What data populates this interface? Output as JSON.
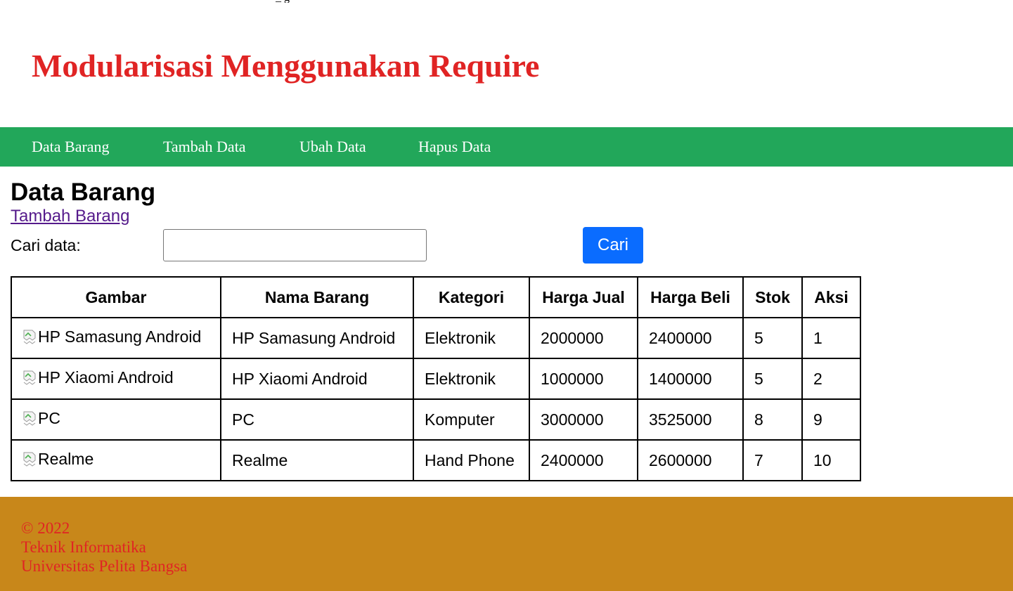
{
  "page_title": "Modularisasi Menggunakan Require",
  "nav": {
    "items": [
      {
        "label": "Data Barang"
      },
      {
        "label": "Tambah Data"
      },
      {
        "label": "Ubah Data"
      },
      {
        "label": "Hapus Data"
      }
    ]
  },
  "main": {
    "heading": "Data Barang",
    "add_link": "Tambah Barang",
    "search": {
      "label": "Cari data:",
      "value": "",
      "button_label": "Cari"
    },
    "table": {
      "columns": [
        "Gambar",
        "Nama Barang",
        "Kategori",
        "Harga Jual",
        "Harga Beli",
        "Stok",
        "Aksi"
      ],
      "rows": [
        {
          "gambar_alt": "HP Samasung Android",
          "nama": "HP Samasung Android",
          "kategori": "Elektronik",
          "harga_jual": "2000000",
          "harga_beli": "2400000",
          "stok": "5",
          "aksi": "1"
        },
        {
          "gambar_alt": "HP Xiaomi Android",
          "nama": "HP Xiaomi Android",
          "kategori": "Elektronik",
          "harga_jual": "1000000",
          "harga_beli": "1400000",
          "stok": "5",
          "aksi": "2"
        },
        {
          "gambar_alt": "PC",
          "nama": "PC",
          "kategori": "Komputer",
          "harga_jual": "3000000",
          "harga_beli": "3525000",
          "stok": "8",
          "aksi": "9"
        },
        {
          "gambar_alt": "Realme",
          "nama": "Realme",
          "kategori": "Hand Phone",
          "harga_jual": "2400000",
          "harga_beli": "2600000",
          "stok": "7",
          "aksi": "10"
        }
      ]
    }
  },
  "footer": {
    "lines": [
      "© 2022",
      "Teknik Informatika",
      "Universitas Pelita Bangsa"
    ]
  },
  "colors": {
    "title": "#e02424",
    "nav_background": "#22a75a",
    "button": "#0a6cff",
    "footer_background": "#c8871a",
    "footer_text": "#e02424"
  }
}
